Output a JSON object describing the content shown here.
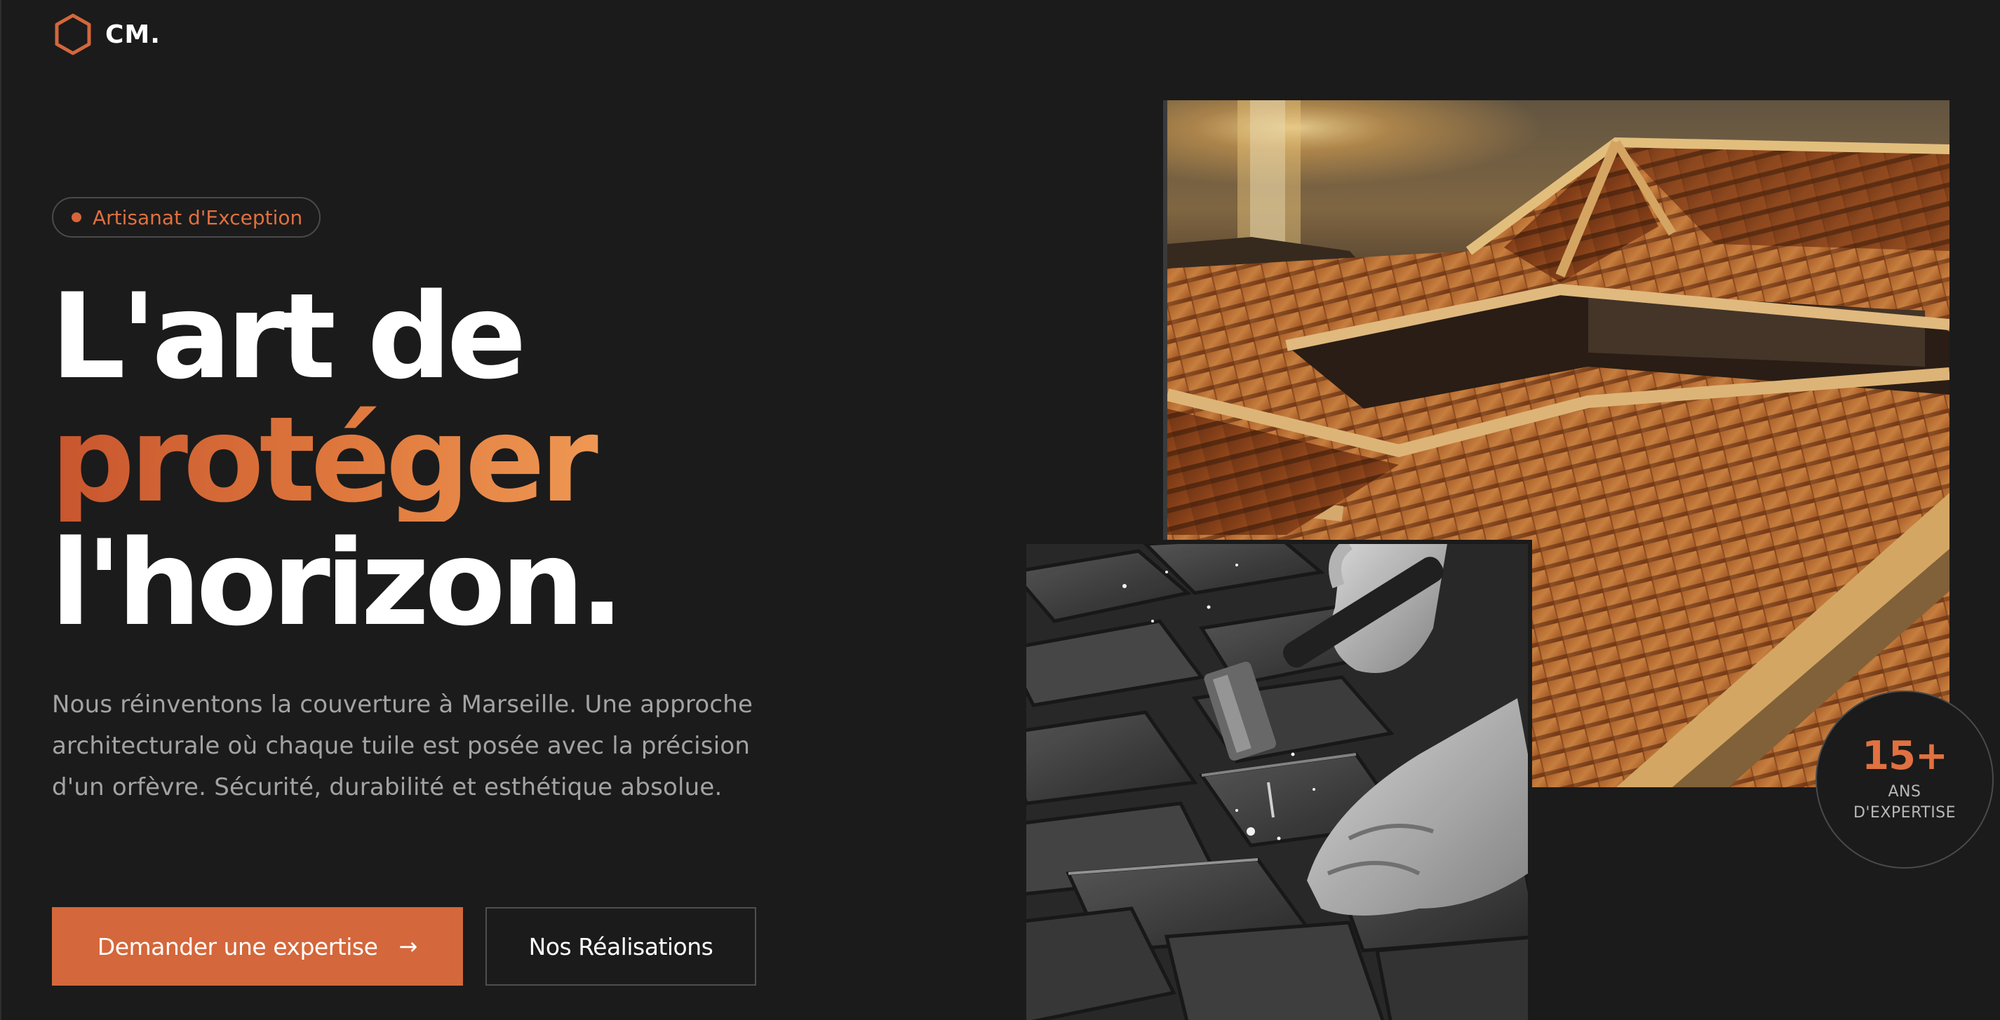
{
  "brand": {
    "name": "CM.",
    "icon": "hexagon-icon",
    "accent_color": "#d4673b"
  },
  "hero": {
    "badge_label": "Artisanat d'Exception",
    "headline": {
      "line1": "L'art de",
      "line2": "protéger",
      "line3": "l'horizon."
    },
    "description": "Nous réinventons la couverture à Marseille. Une approche architecturale où chaque tuile est posée avec la précision d'un orfèvre. Sécurité, durabilité et esthétique absolue.",
    "primary_cta": {
      "label": "Demander une expertise",
      "icon": "arrow-right-icon"
    },
    "secondary_cta": {
      "label": "Nos Réalisations"
    }
  },
  "stat": {
    "value": "15+",
    "label_line1": "ANS",
    "label_line2": "D'EXPERTISE"
  },
  "images": {
    "roof_photo": "terracotta-roof-sunset-photo",
    "worker_photo": "roofer-hammering-slate-photo"
  },
  "colors": {
    "background": "#1b1b1b",
    "accent": "#d4673b",
    "gradient_start": "#c8552e",
    "gradient_end": "#f09a55",
    "muted_text": "#a3a3a3"
  }
}
